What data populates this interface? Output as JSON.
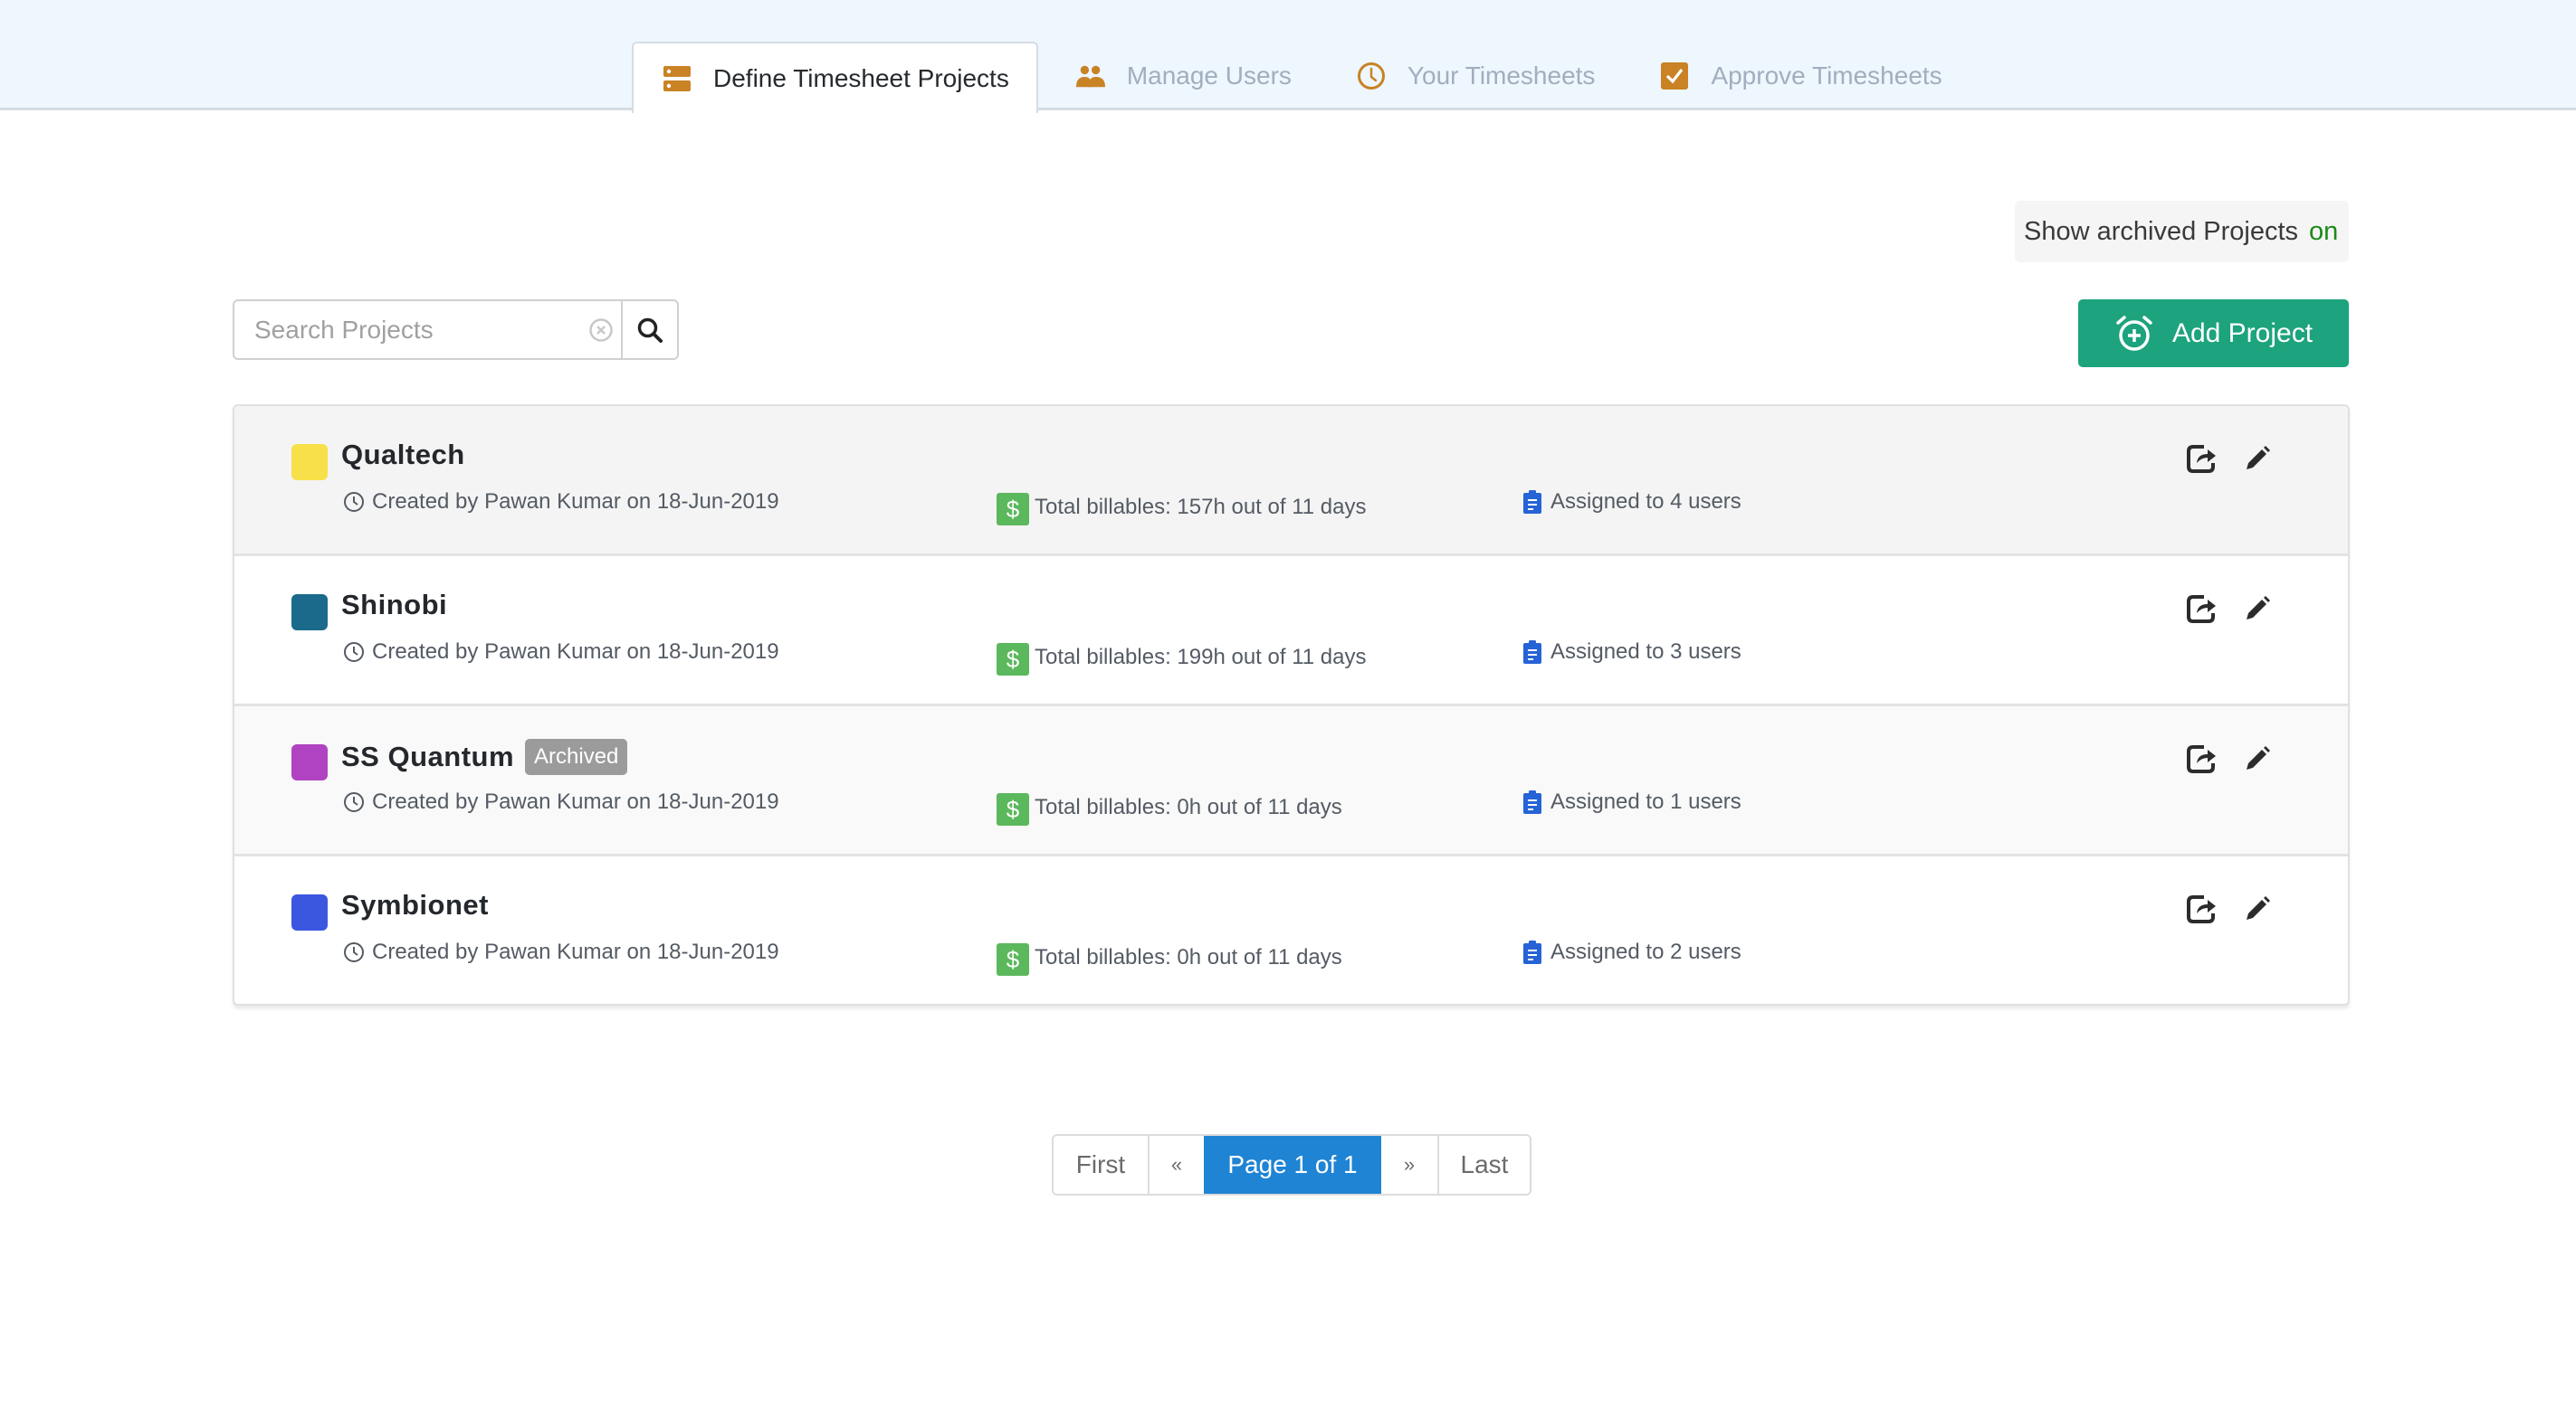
{
  "nav": {
    "tabs": [
      {
        "label": "Define Timesheet Projects",
        "icon": "server-icon",
        "active": true
      },
      {
        "label": "Manage Users",
        "icon": "users-icon",
        "active": false
      },
      {
        "label": "Your Timesheets",
        "icon": "clock-icon",
        "active": false
      },
      {
        "label": "Approve Timesheets",
        "icon": "checkbox-icon",
        "active": false
      }
    ],
    "accent_color": "#c98224"
  },
  "toolbar": {
    "archived_toggle_label": "Show archived Projects",
    "archived_toggle_state": "on",
    "search_placeholder": "Search Projects",
    "search_value": "",
    "add_project_label": "Add Project",
    "add_color": "#1da37d"
  },
  "projects": [
    {
      "name": "Qualtech",
      "color": "#f8e04a",
      "archived": false,
      "badge": "",
      "created": "Created by Pawan Kumar on 18-Jun-2019",
      "billables": "Total billables: 157h out of 11 days",
      "assigned": "Assigned to 4 users"
    },
    {
      "name": "Shinobi",
      "color": "#1b6a8c",
      "archived": false,
      "badge": "",
      "created": "Created by Pawan Kumar on 18-Jun-2019",
      "billables": "Total billables: 199h out of 11 days",
      "assigned": "Assigned to 3 users"
    },
    {
      "name": "SS Quantum",
      "color": "#b043c1",
      "archived": true,
      "badge": "Archived",
      "created": "Created by Pawan Kumar on 18-Jun-2019",
      "billables": "Total billables: 0h out of 11 days",
      "assigned": "Assigned to 1 users"
    },
    {
      "name": "Symbionet",
      "color": "#3b57e0",
      "archived": false,
      "badge": "",
      "created": "Created by Pawan Kumar on 18-Jun-2019",
      "billables": "Total billables: 0h out of 11 days",
      "assigned": "Assigned to 2 users"
    }
  ],
  "row_backgrounds": [
    "#f4f4f4",
    "#ffffff",
    "#f9f9f9",
    "#ffffff"
  ],
  "icons": {
    "dollar": "$"
  },
  "pagination": {
    "first": "First",
    "prev": "«",
    "current": "Page 1 of 1",
    "next": "»",
    "last": "Last",
    "page": 1,
    "total_pages": 1
  }
}
